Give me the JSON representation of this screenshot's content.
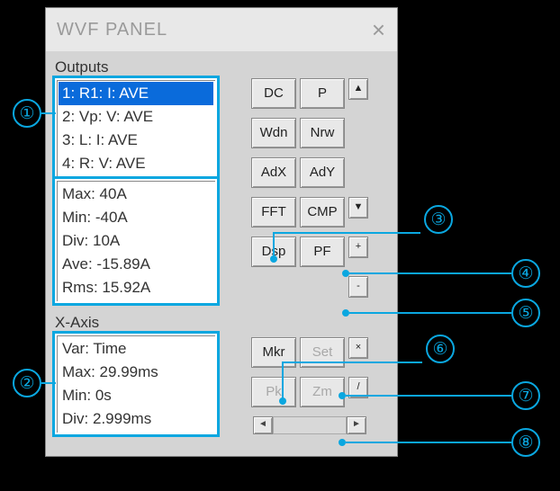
{
  "dialog": {
    "title": "WVF PANEL"
  },
  "outputs": {
    "label": "Outputs",
    "items": [
      "1: R1: I: AVE",
      "2: Vp: V: AVE",
      "3: L: I: AVE",
      "4: R: V: AVE"
    ],
    "selected_index": 0,
    "stats": {
      "max": "Max: 40A",
      "min": "Min: -40A",
      "div": "Div: 10A",
      "ave": "Ave: -15.89A",
      "rms": "Rms: 15.92A"
    }
  },
  "xaxis": {
    "label": "X-Axis",
    "var": "Var: Time",
    "max": "Max: 29.99ms",
    "min": "Min: 0s",
    "div": "Div: 2.999ms"
  },
  "buttons": {
    "dc": "DC",
    "p": "P",
    "wdn": "Wdn",
    "nrw": "Nrw",
    "adx": "AdX",
    "ady": "AdY",
    "fft": "FFT",
    "cmp": "CMP",
    "dsp": "Dsp",
    "pf": "PF",
    "mkr": "Mkr",
    "set": "Set",
    "pk": "Pk",
    "zm": "Zm"
  },
  "scroll": {
    "up": "▲",
    "down": "▼",
    "plus": "+",
    "minus": "-",
    "mul": "×",
    "div": "/",
    "left": "◄",
    "right": "►"
  },
  "callouts": {
    "c1": "①",
    "c2": "②",
    "c3": "③",
    "c4": "④",
    "c5": "⑤",
    "c6": "⑥",
    "c7": "⑦",
    "c8": "⑧"
  }
}
